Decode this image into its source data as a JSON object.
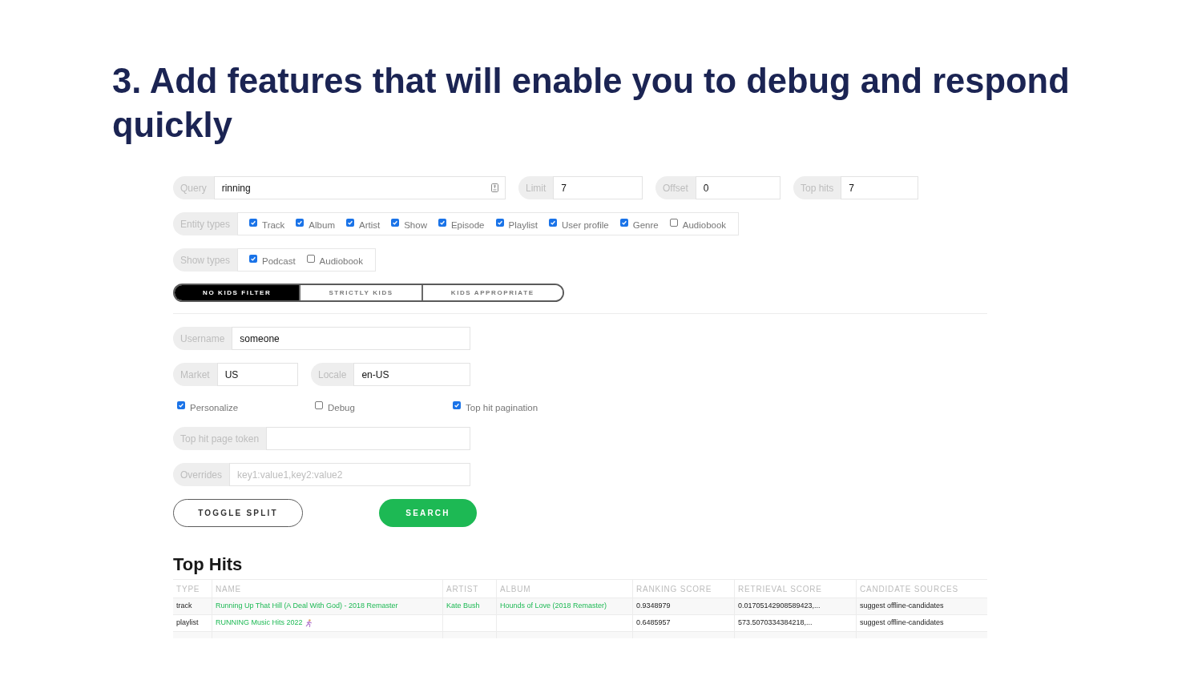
{
  "slide": {
    "title": "3. Add features that will enable you to debug and respond quickly"
  },
  "search_form": {
    "query": {
      "label": "Query",
      "value": "rinning"
    },
    "limit": {
      "label": "Limit",
      "value": "7"
    },
    "offset": {
      "label": "Offset",
      "value": "0"
    },
    "top_hits": {
      "label": "Top hits",
      "value": "7"
    },
    "entity_types": {
      "label": "Entity types",
      "options": [
        {
          "label": "Track",
          "checked": true
        },
        {
          "label": "Album",
          "checked": true
        },
        {
          "label": "Artist",
          "checked": true
        },
        {
          "label": "Show",
          "checked": true
        },
        {
          "label": "Episode",
          "checked": true
        },
        {
          "label": "Playlist",
          "checked": true
        },
        {
          "label": "User profile",
          "checked": true
        },
        {
          "label": "Genre",
          "checked": true
        },
        {
          "label": "Audiobook",
          "checked": false
        }
      ]
    },
    "show_types": {
      "label": "Show types",
      "options": [
        {
          "label": "Podcast",
          "checked": true
        },
        {
          "label": "Audiobook",
          "checked": false
        }
      ]
    },
    "kids_filter": [
      {
        "label": "NO KIDS FILTER",
        "selected": true
      },
      {
        "label": "STRICTLY KIDS",
        "selected": false
      },
      {
        "label": "KIDS APPROPRIATE",
        "selected": false
      }
    ],
    "username": {
      "label": "Username",
      "value": "someone"
    },
    "market": {
      "label": "Market",
      "value": "US"
    },
    "locale": {
      "label": "Locale",
      "value": "en-US"
    },
    "flags": [
      {
        "label": "Personalize",
        "checked": true
      },
      {
        "label": "Debug",
        "checked": false
      },
      {
        "label": "Top hit pagination",
        "checked": true
      }
    ],
    "top_hit_page_token": {
      "label": "Top hit page token"
    },
    "overrides": {
      "label": "Overrides",
      "placeholder": "key1:value1,key2:value2"
    },
    "buttons": [
      {
        "label": "TOGGLE SPLIT",
        "kind": "outline"
      },
      {
        "label": "SEARCH",
        "kind": "primary"
      }
    ]
  },
  "results": {
    "title": "Top Hits",
    "columns": [
      "TYPE",
      "NAME",
      "ARTIST",
      "ALBUM",
      "RANKING SCORE",
      "RETRIEVAL SCORE",
      "CANDIDATE SOURCES"
    ],
    "rows": [
      {
        "type": "track",
        "name": "Running Up That Hill (A Deal With God) - 2018 Remaster",
        "runner_emoji": false,
        "artist": "Kate Bush",
        "album": "Hounds of Love (2018 Remaster)",
        "ranking_score": "0.9348979",
        "retrieval_score": "0.01705142908589423,...",
        "candidate_sources": "suggest offline-candidates"
      },
      {
        "type": "playlist",
        "name": "RUNNING Music Hits 2022",
        "runner_emoji": true,
        "ranking_score": "0.6485957",
        "retrieval_score": "573.5070334384218,...",
        "candidate_sources": "suggest offline-candidates"
      }
    ]
  }
}
